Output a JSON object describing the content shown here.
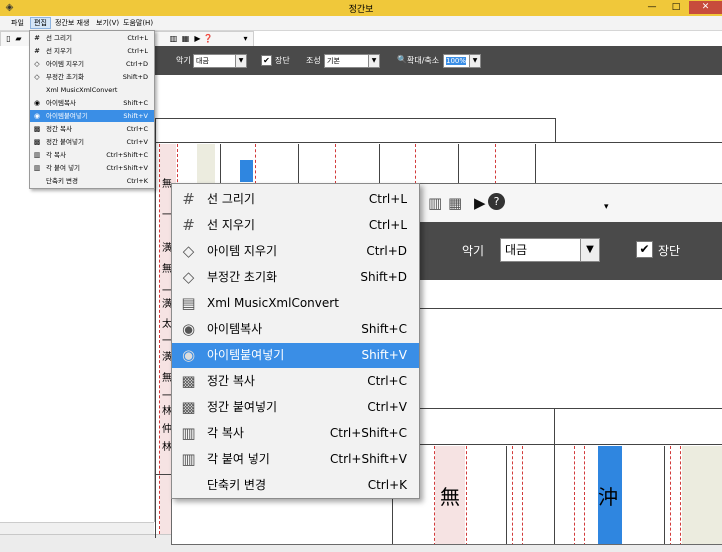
{
  "window": {
    "title": "정간보",
    "minimize": "—",
    "maximize": "□",
    "close": "✕"
  },
  "menubar": {
    "items": [
      "파일",
      "편집",
      "정간보 재생",
      "보기(V)",
      "도움말(H)"
    ]
  },
  "options": {
    "instrument_label": "악기",
    "instrument_value": "대금",
    "jangdan_label": "장단",
    "jangdan_checked": "✔",
    "key_label": "조성",
    "key_value": "기본",
    "zoom_label": "확대/축소",
    "zoom_value": "100%"
  },
  "edit_menu": {
    "items": [
      {
        "label": "선 그리기",
        "shortcut": "Ctrl+L",
        "icon": "grid-draw-icon"
      },
      {
        "label": "선 지우기",
        "shortcut": "Ctrl+L",
        "icon": "grid-erase-icon"
      },
      {
        "label": "아이템 지우기",
        "shortcut": "Ctrl+D",
        "icon": "eraser-icon"
      },
      {
        "label": "부정간 초기화",
        "shortcut": "Shift+D",
        "icon": "reset-icon"
      },
      {
        "label": "Xml MusicXmlConvert",
        "shortcut": "",
        "icon": "xml-convert-icon"
      },
      {
        "label": "아이템복사",
        "shortcut": "Shift+C",
        "icon": "copy-item-icon"
      },
      {
        "label": "아이템붙여넣기",
        "shortcut": "Shift+V",
        "icon": "paste-item-icon"
      },
      {
        "label": "정간 복사",
        "shortcut": "Ctrl+C",
        "icon": "copy-cell-icon"
      },
      {
        "label": "정간 붙여넣기",
        "shortcut": "Ctrl+V",
        "icon": "paste-cell-icon"
      },
      {
        "label": "각 복사",
        "shortcut": "Ctrl+Shift+C",
        "icon": "copy-gak-icon"
      },
      {
        "label": "각 붙여 넣기",
        "shortcut": "Ctrl+Shift+V",
        "icon": "paste-gak-icon"
      },
      {
        "label": "단축키 변경",
        "shortcut": "Ctrl+K",
        "icon": ""
      }
    ],
    "highlighted_index": 6
  },
  "score": {
    "left_column_chars": [
      "無",
      "一",
      "潢",
      "無",
      "一",
      "潢",
      "太",
      "一",
      "潢",
      "無",
      "一",
      "林",
      "仲",
      "林"
    ],
    "zoom_cells": [
      "無",
      "沖"
    ]
  },
  "colors": {
    "highlight": "#3a8ee6",
    "titlebar": "#f0c83a",
    "darkbar": "#4a4a4a",
    "blue_cell": "#2f86e0"
  }
}
